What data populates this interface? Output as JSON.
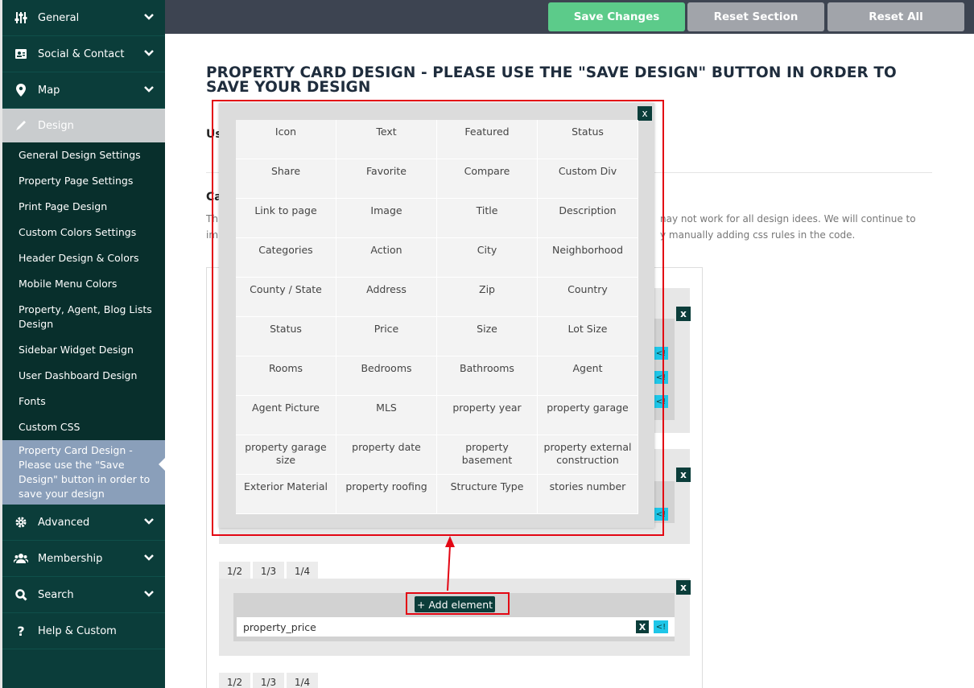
{
  "sidebar": {
    "main_top": [
      {
        "label": "General",
        "icon": "sliders-icon"
      },
      {
        "label": "Social & Contact",
        "icon": "contact-card-icon"
      },
      {
        "label": "Map",
        "icon": "map-marker-icon"
      },
      {
        "label": "Design",
        "icon": "pencil-icon"
      }
    ],
    "sub_items": [
      "General Design Settings",
      "Property Page Settings",
      "Print Page Design",
      "Custom Colors Settings",
      "Header Design & Colors",
      "Mobile Menu Colors",
      "Property, Agent, Blog Lists Design",
      "Sidebar Widget Design",
      "User Dashboard Design",
      "Fonts",
      "Custom CSS",
      "Property Card Design - Please use the \"Save Design\" button in order to save your design"
    ],
    "main_bottom": [
      {
        "label": "Advanced",
        "icon": "gear-icon"
      },
      {
        "label": "Membership",
        "icon": "users-icon"
      },
      {
        "label": "Search",
        "icon": "search-icon"
      },
      {
        "label": "Help & Custom",
        "icon": "question-icon"
      }
    ]
  },
  "toolbar": {
    "save_label": "Save Changes",
    "reset_section_label": "Reset Section",
    "reset_all_label": "Reset All"
  },
  "page": {
    "title": "PROPERTY CARD DESIGN - PLEASE USE THE \"SAVE DESIGN\" BUTTON IN ORDER TO SAVE YOUR DESIGN",
    "peek": {
      "use_label": "Us",
      "card_label": "Ca",
      "text_line1_left": "This",
      "text_line2_left": "imp",
      "text_line1_right": "nay not work for all design idees. We will continue to",
      "text_line2_right": "y manually adding css rules in the code."
    }
  },
  "builder": {
    "tabs": [
      "1/2",
      "1/3",
      "1/4"
    ],
    "add_element_label": "+ Add element",
    "field_value": "property_price",
    "x_label": "x",
    "remove_label": "X",
    "move_label": "<!"
  },
  "popup": {
    "close_label": "x",
    "elements": [
      "Icon",
      "Text",
      "Featured",
      "Status",
      "Share",
      "Favorite",
      "Compare",
      "Custom Div",
      "Link to page",
      "Image",
      "Title",
      "Description",
      "Categories",
      "Action",
      "City",
      "Neighborhood",
      "County / State",
      "Address",
      "Zip",
      "Country",
      "Status",
      "Price",
      "Size",
      "Lot Size",
      "Rooms",
      "Bedrooms",
      "Bathrooms",
      "Agent",
      "Agent Picture",
      "MLS",
      "property year",
      "property garage",
      "property garage size",
      "property date",
      "property basement",
      "property external construction",
      "Exterior Material",
      "property roofing",
      "Structure Type",
      "stories number"
    ]
  },
  "colors": {
    "sidebar_bg": "#0b3d3a",
    "save_green": "#5ccb8a",
    "reset_gray": "#a1a4aa",
    "highlight_red": "#e30613"
  }
}
